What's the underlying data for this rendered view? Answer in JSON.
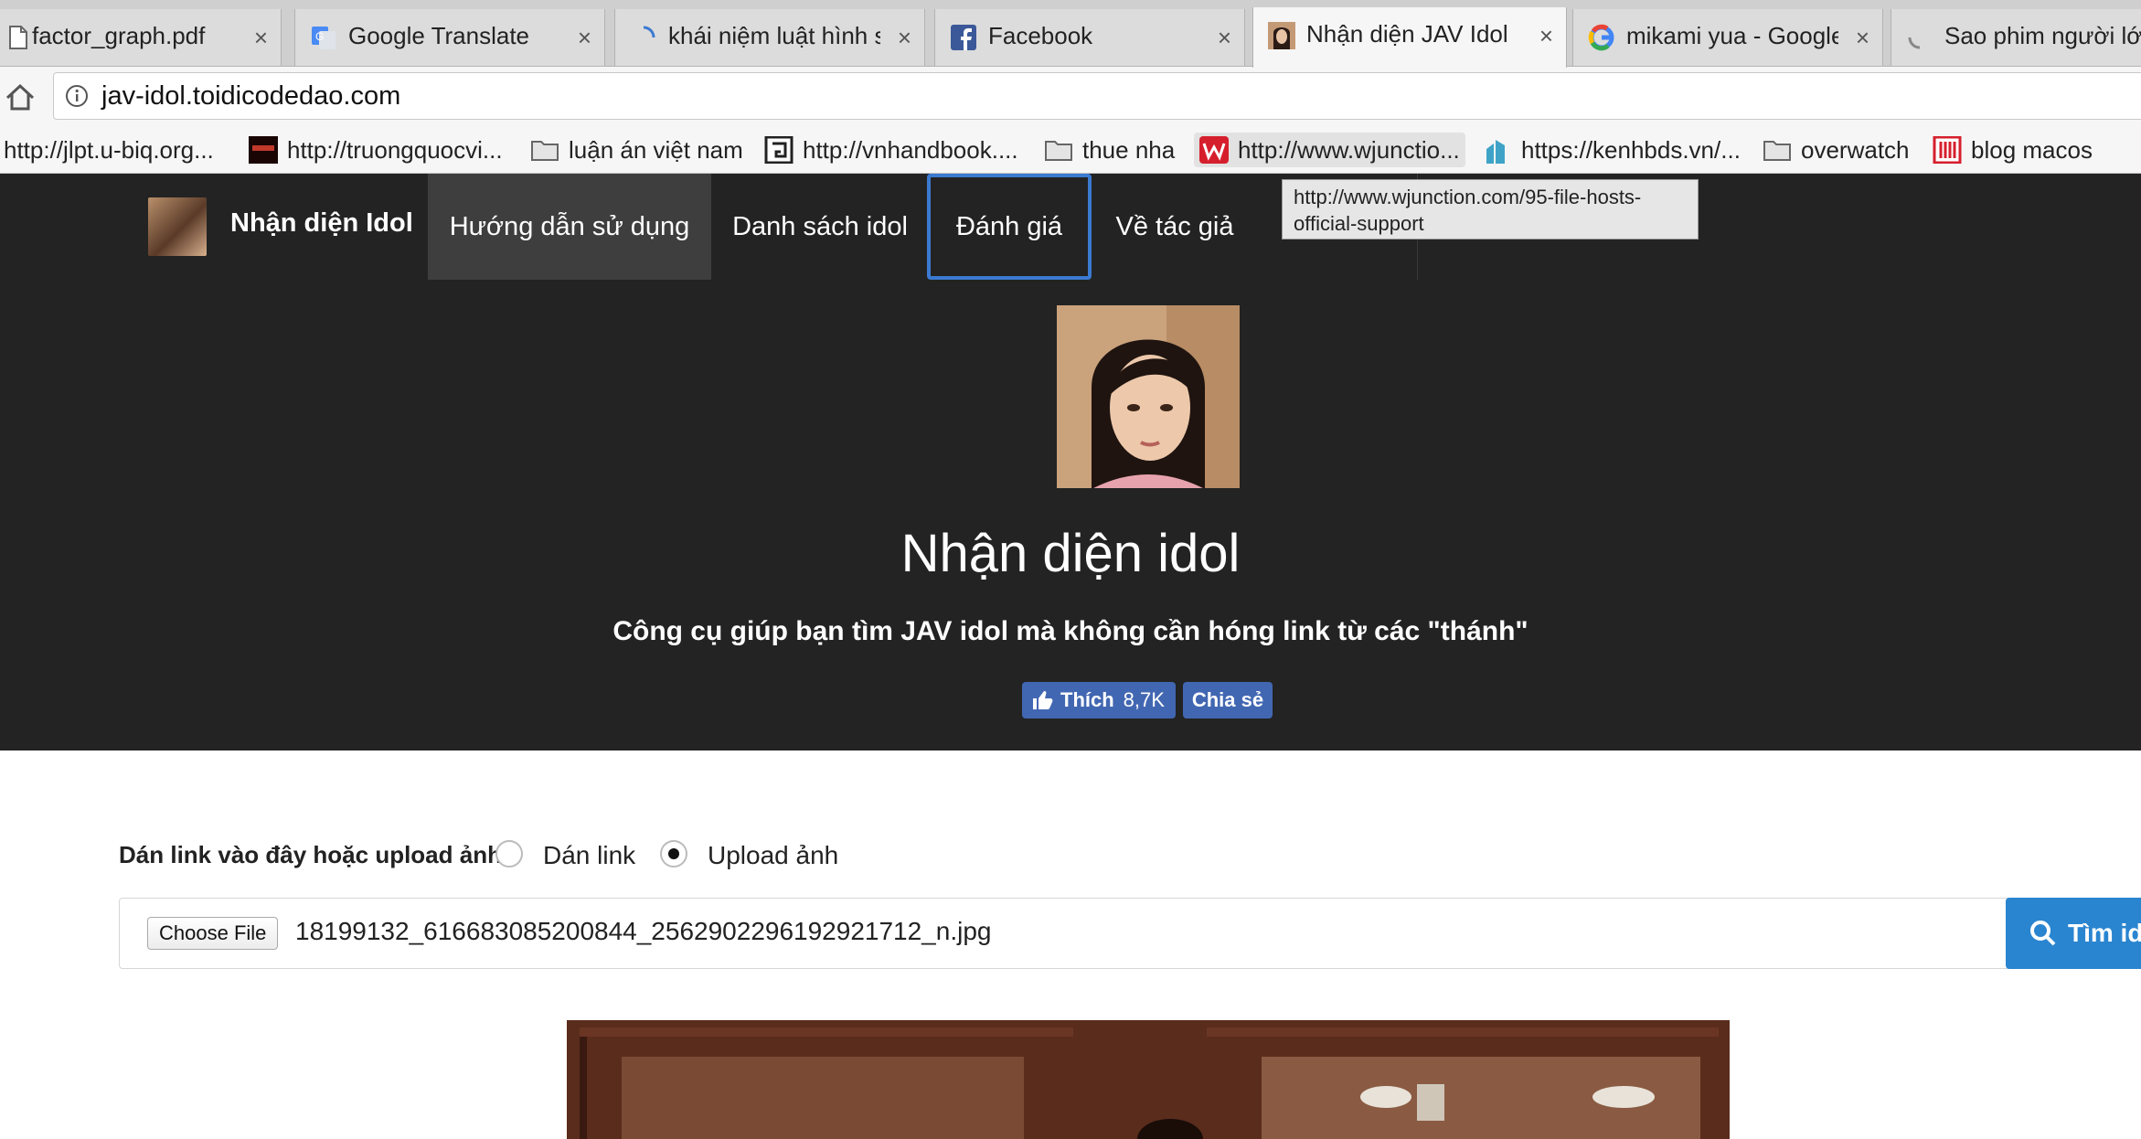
{
  "tabs": [
    {
      "title": "factor_graph.pdf",
      "icon": "document-icon"
    },
    {
      "title": "Google Translate",
      "icon": "google-translate-icon"
    },
    {
      "title": "khái niệm luật hình sự",
      "icon": "loading-spinner-icon"
    },
    {
      "title": "Facebook",
      "icon": "facebook-icon"
    },
    {
      "title": "Nhận diện JAV Idol",
      "icon": "idol-favicon"
    },
    {
      "title": "mikami yua - Google",
      "icon": "google-icon"
    },
    {
      "title": "Sao phim người lớn",
      "icon": "loading-spinner-icon"
    }
  ],
  "close_glyph": "×",
  "address": {
    "url": "jav-idol.toidicodedao.com"
  },
  "bookmarks": [
    {
      "label": "http://jlpt.u-biq.org...",
      "icon": "page-icon"
    },
    {
      "label": "http://truongquocvi...",
      "icon": "site-favicon"
    },
    {
      "label": "luận án việt nam",
      "icon": "folder-icon"
    },
    {
      "label": "http://vnhandbook....",
      "icon": "site-favicon"
    },
    {
      "label": "thue nha",
      "icon": "folder-icon"
    },
    {
      "label": "http://www.wjunctio...",
      "icon": "w-favicon"
    },
    {
      "label": "https://kenhbds.vn/...",
      "icon": "building-favicon"
    },
    {
      "label": "overwatch",
      "icon": "folder-icon"
    },
    {
      "label": "blog macos",
      "icon": "site-favicon"
    }
  ],
  "nav": {
    "brand": "Nhận diện Idol",
    "items": [
      "Hướng dẫn sử dụng",
      "Danh sách idol",
      "Đánh giá",
      "Về tác giả"
    ]
  },
  "tooltip": {
    "line1": "http://www.wjunction.com/95-file-hosts-",
    "line2": "official-support"
  },
  "hero": {
    "title": "Nhận diện idol",
    "subtitle": "Công cụ giúp bạn tìm JAV idol mà không cần hóng link từ các \"thánh\"",
    "like_label": "Thích",
    "like_count": "8,7K",
    "share_label": "Chia sẻ"
  },
  "form": {
    "label": "Dán link vào đây hoặc upload ảnh",
    "option_link": "Dán link",
    "option_upload": "Upload ảnh",
    "selected": "upload",
    "choose_file": "Choose File",
    "file_name": "18199132_616683085200844_2562902296192921712_n.jpg",
    "search_label": "Tìm idol"
  },
  "colors": {
    "dark_bg": "#232323",
    "accent": "#2a85d0",
    "facebook": "#4267b2"
  }
}
